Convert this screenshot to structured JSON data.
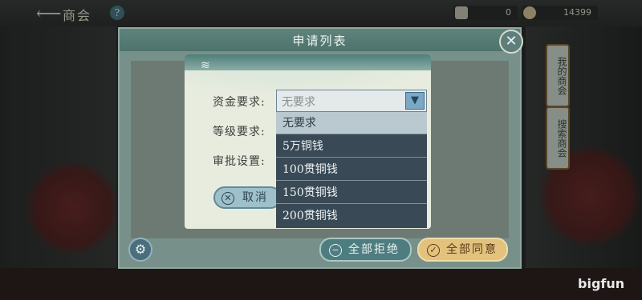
{
  "top_bar": {
    "back_icon": "back-arrow-icon",
    "title": "商会",
    "help_icon": "help-icon",
    "resources": [
      {
        "icon": "scroll-icon",
        "value": "0"
      },
      {
        "icon": "coin-icon",
        "value": "14399"
      }
    ]
  },
  "side_tabs": [
    {
      "label": "我的商会"
    },
    {
      "label": "搜索商会"
    }
  ],
  "dialog": {
    "title": "申请列表",
    "close_icon": "close-icon",
    "settings_icon": "gear-icon",
    "reject_all_label": "全部拒绝",
    "approve_all_label": "全部同意"
  },
  "settings_panel": {
    "fund_label": "资金要求:",
    "level_label": "等级要求:",
    "approval_label": "审批设置:",
    "cancel_label": "取消",
    "fund_select": {
      "value": "无要求",
      "options": [
        "无要求",
        "5万铜钱",
        "100贯铜钱",
        "150贯铜钱",
        "200贯铜钱"
      ],
      "selected_index": 0
    }
  },
  "watermark": "bigfun",
  "colors": {
    "dialog_header": "#4e736c",
    "panel_bg": "#e7ecdf",
    "dropdown_bg": "#394a56",
    "agree_button": "#e3c27e",
    "reject_button": "#4e7d80"
  }
}
